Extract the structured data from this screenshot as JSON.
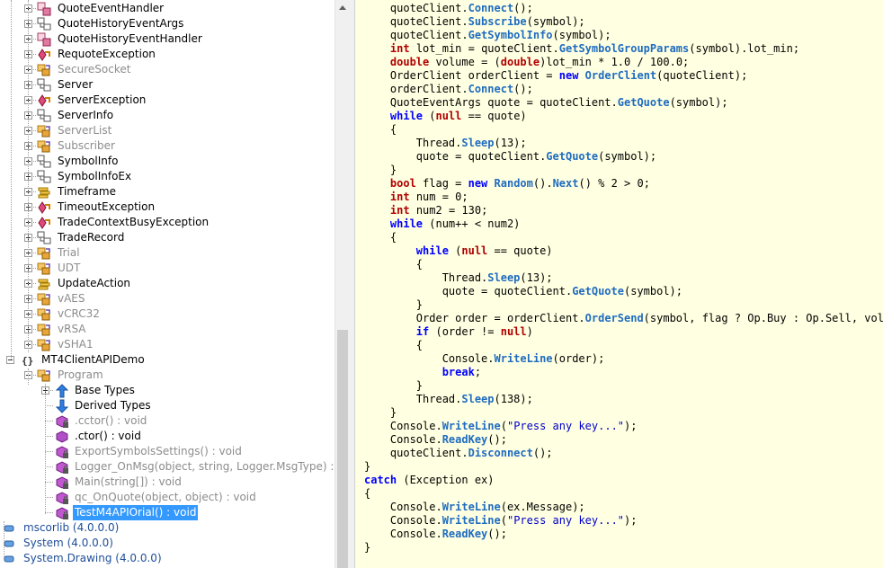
{
  "tree": {
    "rows": [
      {
        "label": "QuoteEventHandler",
        "type": "delegate",
        "expander": "plus",
        "indent": 1,
        "dim": false
      },
      {
        "label": "QuoteHistoryEventArgs",
        "type": "class",
        "expander": "plus",
        "indent": 1,
        "dim": false
      },
      {
        "label": "QuoteHistoryEventHandler",
        "type": "delegate",
        "expander": "plus",
        "indent": 1,
        "dim": false
      },
      {
        "label": "RequoteException",
        "type": "exception",
        "expander": "plus",
        "indent": 1,
        "dim": false
      },
      {
        "label": "SecureSocket",
        "type": "class-internal",
        "expander": "plus",
        "indent": 1,
        "dim": true
      },
      {
        "label": "Server",
        "type": "class",
        "expander": "plus",
        "indent": 1,
        "dim": false
      },
      {
        "label": "ServerException",
        "type": "exception",
        "expander": "plus",
        "indent": 1,
        "dim": false
      },
      {
        "label": "ServerInfo",
        "type": "class",
        "expander": "plus",
        "indent": 1,
        "dim": false
      },
      {
        "label": "ServerList",
        "type": "class-internal",
        "expander": "plus",
        "indent": 1,
        "dim": true
      },
      {
        "label": "Subscriber",
        "type": "class-internal",
        "expander": "plus",
        "indent": 1,
        "dim": true
      },
      {
        "label": "SymbolInfo",
        "type": "class",
        "expander": "plus",
        "indent": 1,
        "dim": false
      },
      {
        "label": "SymbolInfoEx",
        "type": "class",
        "expander": "plus",
        "indent": 1,
        "dim": false
      },
      {
        "label": "Timeframe",
        "type": "enum",
        "expander": "plus",
        "indent": 1,
        "dim": false
      },
      {
        "label": "TimeoutException",
        "type": "exception",
        "expander": "plus",
        "indent": 1,
        "dim": false
      },
      {
        "label": "TradeContextBusyException",
        "type": "exception",
        "expander": "plus",
        "indent": 1,
        "dim": false
      },
      {
        "label": "TradeRecord",
        "type": "class",
        "expander": "plus",
        "indent": 1,
        "dim": false
      },
      {
        "label": "Trial",
        "type": "class-internal",
        "expander": "plus",
        "indent": 1,
        "dim": true
      },
      {
        "label": "UDT",
        "type": "class-internal",
        "expander": "plus",
        "indent": 1,
        "dim": true
      },
      {
        "label": "UpdateAction",
        "type": "enum",
        "expander": "plus",
        "indent": 1,
        "dim": false
      },
      {
        "label": "vAES",
        "type": "class-internal",
        "expander": "plus",
        "indent": 1,
        "dim": true
      },
      {
        "label": "vCRC32",
        "type": "class-internal",
        "expander": "plus",
        "indent": 1,
        "dim": true
      },
      {
        "label": "vRSA",
        "type": "class-internal",
        "expander": "plus",
        "indent": 1,
        "dim": true
      },
      {
        "label": "vSHA1",
        "type": "class-internal",
        "expander": "plus",
        "indent": 1,
        "dim": true
      },
      {
        "label": "MT4ClientAPIDemo",
        "type": "namespace",
        "expander": "minus",
        "indent": 0,
        "dim": false
      },
      {
        "label": "Program",
        "type": "class-internal",
        "expander": "minus",
        "indent": 1,
        "dim": true
      },
      {
        "label": "Base Types",
        "type": "base-types",
        "expander": "plus",
        "indent": 2,
        "dim": false
      },
      {
        "label": "Derived Types",
        "type": "derived-types",
        "expander": "none",
        "indent": 2,
        "dim": false
      },
      {
        "label": ".cctor() : void",
        "type": "method-private",
        "expander": "none",
        "indent": 2,
        "dim": true
      },
      {
        "label": ".ctor() : void",
        "type": "method-public",
        "expander": "none",
        "indent": 2,
        "dim": false
      },
      {
        "label": "ExportSymbolsSettings() : void",
        "type": "method-private",
        "expander": "none",
        "indent": 2,
        "dim": true
      },
      {
        "label": "Logger_OnMsg(object, string, Logger.MsgType) :",
        "type": "method-private",
        "expander": "none",
        "indent": 2,
        "dim": true
      },
      {
        "label": "Main(string[]) : void",
        "type": "method-private",
        "expander": "none",
        "indent": 2,
        "dim": true
      },
      {
        "label": "qc_OnQuote(object, object) : void",
        "type": "method-private",
        "expander": "none",
        "indent": 2,
        "dim": true
      },
      {
        "label": "TestM4APIOrial() : void",
        "type": "method-private",
        "expander": "none",
        "indent": 2,
        "dim": false,
        "selected": true
      },
      {
        "label": "mscorlib (4.0.0.0)",
        "type": "assembly",
        "expander": "none",
        "indent": -1,
        "dim": false,
        "asm": true
      },
      {
        "label": "System (4.0.0.0)",
        "type": "assembly",
        "expander": "none",
        "indent": -1,
        "dim": false,
        "asm": true
      },
      {
        "label": "System.Drawing (4.0.0.0)",
        "type": "assembly",
        "expander": "none",
        "indent": -1,
        "dim": false,
        "asm": true
      }
    ]
  },
  "code": {
    "lines": [
      [
        [
          "    quoteClient.",
          ""
        ],
        [
          "Connect",
          "fn"
        ],
        [
          "();",
          ""
        ]
      ],
      [
        [
          "    quoteClient.",
          ""
        ],
        [
          "Subscribe",
          "fn"
        ],
        [
          "(symbol);",
          ""
        ]
      ],
      [
        [
          "    quoteClient.",
          ""
        ],
        [
          "GetSymbolInfo",
          "fn"
        ],
        [
          "(symbol);",
          ""
        ]
      ],
      [
        [
          "    ",
          ""
        ],
        [
          "int",
          "kw"
        ],
        [
          " lot_min = quoteClient.",
          ""
        ],
        [
          "GetSymbolGroupParams",
          "fn"
        ],
        [
          "(symbol).lot_min;",
          ""
        ]
      ],
      [
        [
          "    ",
          ""
        ],
        [
          "double",
          "kw"
        ],
        [
          " volume = (",
          ""
        ],
        [
          "double",
          "kw"
        ],
        [
          ")lot_min * 1.0 / 100.0;",
          ""
        ]
      ],
      [
        [
          "    OrderClient orderClient = ",
          ""
        ],
        [
          "new",
          "kb"
        ],
        [
          " ",
          ""
        ],
        [
          "OrderClient",
          "fn"
        ],
        [
          "(quoteClient);",
          ""
        ]
      ],
      [
        [
          "    orderClient.",
          ""
        ],
        [
          "Connect",
          "fn"
        ],
        [
          "();",
          ""
        ]
      ],
      [
        [
          "    QuoteEventArgs quote = quoteClient.",
          ""
        ],
        [
          "GetQuote",
          "fn"
        ],
        [
          "(symbol);",
          ""
        ]
      ],
      [
        [
          "    ",
          ""
        ],
        [
          "while",
          "kb"
        ],
        [
          " (",
          ""
        ],
        [
          "null",
          "kw"
        ],
        [
          " == quote)",
          ""
        ]
      ],
      [
        [
          "    {",
          ""
        ]
      ],
      [
        [
          "        Thread.",
          ""
        ],
        [
          "Sleep",
          "fn"
        ],
        [
          "(13);",
          ""
        ]
      ],
      [
        [
          "        quote = quoteClient.",
          ""
        ],
        [
          "GetQuote",
          "fn"
        ],
        [
          "(symbol);",
          ""
        ]
      ],
      [
        [
          "    }",
          ""
        ]
      ],
      [
        [
          "    ",
          ""
        ],
        [
          "bool",
          "kw"
        ],
        [
          " flag = ",
          ""
        ],
        [
          "new",
          "kb"
        ],
        [
          " ",
          ""
        ],
        [
          "Random",
          "fn"
        ],
        [
          "().",
          ""
        ],
        [
          "Next",
          "fn"
        ],
        [
          "() % 2 > 0;",
          ""
        ]
      ],
      [
        [
          "    ",
          ""
        ],
        [
          "int",
          "kw"
        ],
        [
          " num = 0;",
          ""
        ]
      ],
      [
        [
          "    ",
          ""
        ],
        [
          "int",
          "kw"
        ],
        [
          " num2 = 130;",
          ""
        ]
      ],
      [
        [
          "    ",
          ""
        ],
        [
          "while",
          "kb"
        ],
        [
          " (num++ < num2)",
          ""
        ]
      ],
      [
        [
          "    {",
          ""
        ]
      ],
      [
        [
          "        ",
          ""
        ],
        [
          "while",
          "kb"
        ],
        [
          " (",
          ""
        ],
        [
          "null",
          "kw"
        ],
        [
          " == quote)",
          ""
        ]
      ],
      [
        [
          "        {",
          ""
        ]
      ],
      [
        [
          "            Thread.",
          ""
        ],
        [
          "Sleep",
          "fn"
        ],
        [
          "(13);",
          ""
        ]
      ],
      [
        [
          "            quote = quoteClient.",
          ""
        ],
        [
          "GetQuote",
          "fn"
        ],
        [
          "(symbol);",
          ""
        ]
      ],
      [
        [
          "        }",
          ""
        ]
      ],
      [
        [
          "        Order order = orderClient.",
          ""
        ],
        [
          "OrderSend",
          "fn"
        ],
        [
          "(symbol, flag ? Op.Buy : Op.Sell, volume",
          ""
        ]
      ],
      [
        [
          "        ",
          ""
        ],
        [
          "if",
          "kb"
        ],
        [
          " (order != ",
          ""
        ],
        [
          "null",
          "kw"
        ],
        [
          ")",
          ""
        ]
      ],
      [
        [
          "        {",
          ""
        ]
      ],
      [
        [
          "            Console.",
          ""
        ],
        [
          "WriteLine",
          "fn"
        ],
        [
          "(order);",
          ""
        ]
      ],
      [
        [
          "            ",
          ""
        ],
        [
          "break",
          "kb"
        ],
        [
          ";",
          ""
        ]
      ],
      [
        [
          "        }",
          ""
        ]
      ],
      [
        [
          "        Thread.",
          ""
        ],
        [
          "Sleep",
          "fn"
        ],
        [
          "(138);",
          ""
        ]
      ],
      [
        [
          "    }",
          ""
        ]
      ],
      [
        [
          "    Console.",
          ""
        ],
        [
          "WriteLine",
          "fn"
        ],
        [
          "(",
          ""
        ],
        [
          "\"Press any key...\"",
          "st"
        ],
        [
          ");",
          ""
        ]
      ],
      [
        [
          "    Console.",
          ""
        ],
        [
          "ReadKey",
          "fn"
        ],
        [
          "();",
          ""
        ]
      ],
      [
        [
          "    quoteClient.",
          ""
        ],
        [
          "Disconnect",
          "fn"
        ],
        [
          "();",
          ""
        ]
      ],
      [
        [
          "}",
          ""
        ]
      ],
      [
        [
          "catch",
          "kb"
        ],
        [
          " (Exception ex)",
          ""
        ]
      ],
      [
        [
          "{",
          ""
        ]
      ],
      [
        [
          "    Console.",
          ""
        ],
        [
          "WriteLine",
          "fn"
        ],
        [
          "(ex.Message);",
          ""
        ]
      ],
      [
        [
          "    Console.",
          ""
        ],
        [
          "WriteLine",
          "fn"
        ],
        [
          "(",
          ""
        ],
        [
          "\"Press any key...\"",
          "st"
        ],
        [
          ");",
          ""
        ]
      ],
      [
        [
          "    Console.",
          ""
        ],
        [
          "ReadKey",
          "fn"
        ],
        [
          "();",
          ""
        ]
      ],
      [
        [
          "}",
          ""
        ]
      ]
    ]
  }
}
